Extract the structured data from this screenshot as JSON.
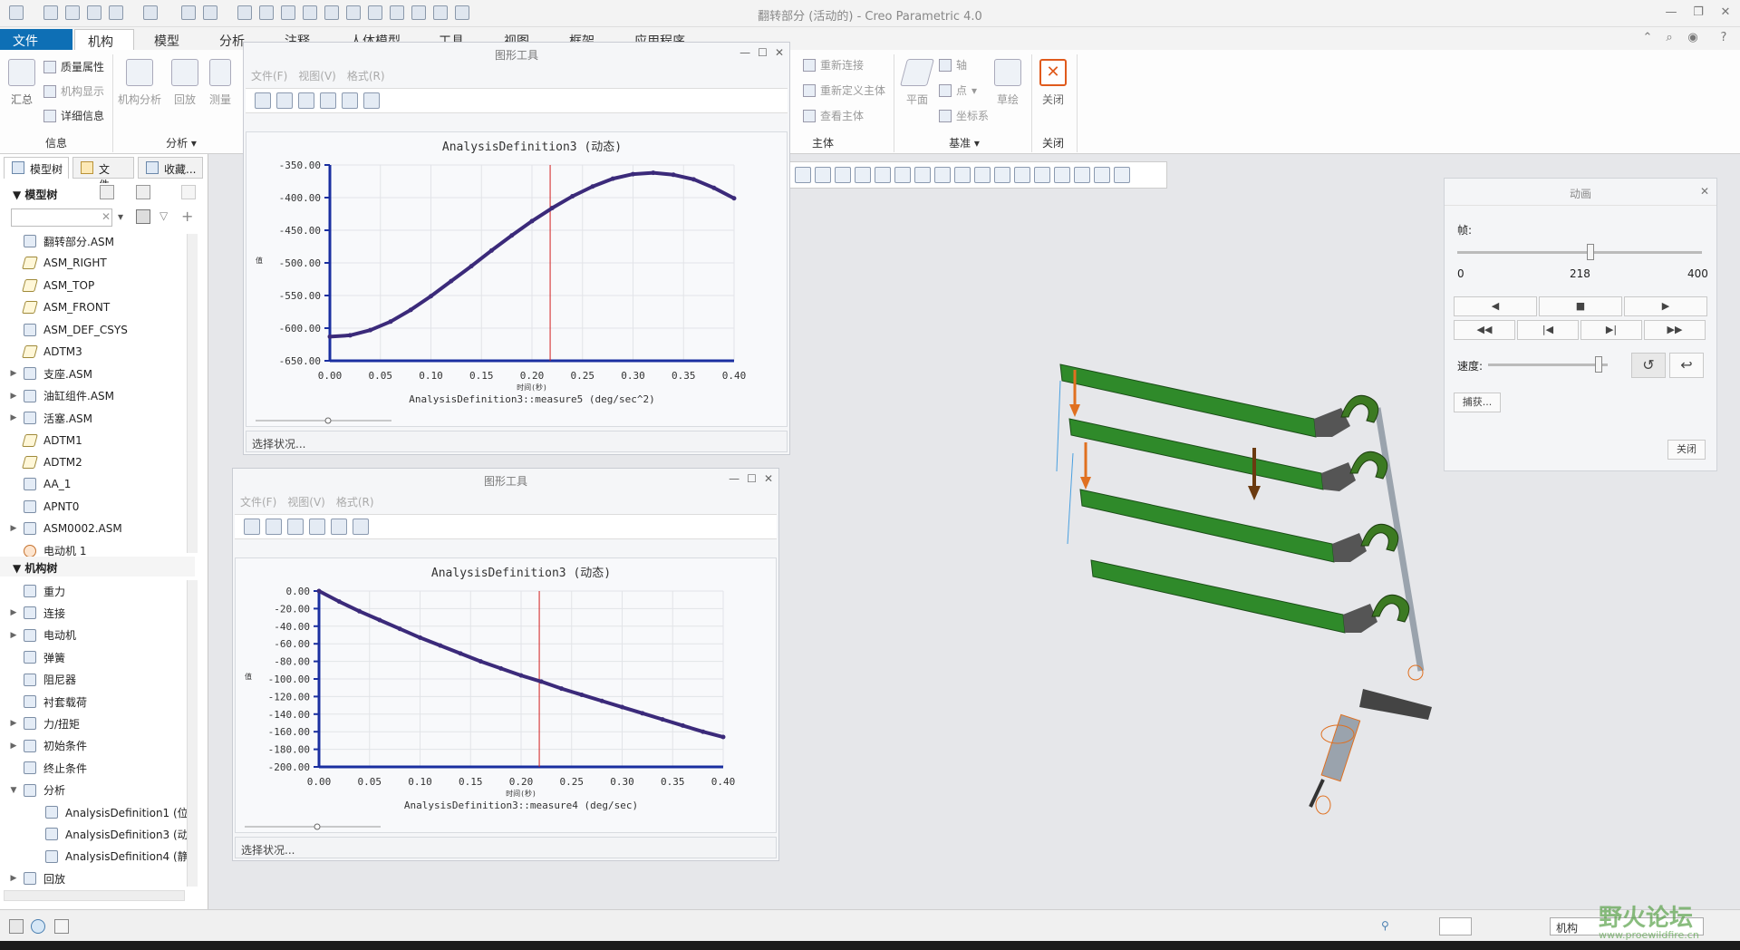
{
  "window": {
    "title": "翻转部分 (活动的) - Creo Parametric 4.0"
  },
  "tabs": [
    "文件",
    "机构",
    "模型",
    "分析",
    "注释",
    "人体模型",
    "工具",
    "视图",
    "框架",
    "应用程序"
  ],
  "ribbon": {
    "info_group": {
      "summary": "汇总",
      "mass_props": "质量属性",
      "mech_display": "机构显示",
      "details": "详细信息",
      "label": "信息"
    },
    "analysis_group": {
      "mech_analysis": "机构分析",
      "playback": "回放",
      "measure": "测量",
      "label": "分析"
    },
    "body_group": {
      "reconnect": "重新连接",
      "redefine_body": "重新定义主体",
      "view_body": "查看主体",
      "label": "主体"
    },
    "datum_group": {
      "plane": "平面",
      "axis": "轴",
      "point": "点",
      "csys": "坐标系",
      "sketch": "草绘",
      "label": "基准"
    },
    "close_group": {
      "close": "关闭",
      "label": "关闭"
    }
  },
  "left_panel": {
    "tabs": [
      "模型树",
      "文件...",
      "收藏..."
    ],
    "model_tree_label": "模型树",
    "model_items": [
      {
        "label": "翻转部分.ASM",
        "type": "asm",
        "expand": ""
      },
      {
        "label": "ASM_RIGHT",
        "type": "datum",
        "expand": ""
      },
      {
        "label": "ASM_TOP",
        "type": "datum",
        "expand": ""
      },
      {
        "label": "ASM_FRONT",
        "type": "datum",
        "expand": ""
      },
      {
        "label": "ASM_DEF_CSYS",
        "type": "csys",
        "expand": ""
      },
      {
        "label": "ADTM3",
        "type": "datum",
        "expand": ""
      },
      {
        "label": "支座.ASM",
        "type": "asm",
        "expand": "▶"
      },
      {
        "label": "油缸组件.ASM",
        "type": "asm",
        "expand": "▶"
      },
      {
        "label": "活塞.ASM",
        "type": "asm",
        "expand": "▶"
      },
      {
        "label": "ADTM1",
        "type": "datum",
        "expand": ""
      },
      {
        "label": "ADTM2",
        "type": "datum",
        "expand": ""
      },
      {
        "label": "AA_1",
        "type": "axis",
        "expand": ""
      },
      {
        "label": "APNT0",
        "type": "point",
        "expand": ""
      },
      {
        "label": "ASM0002.ASM",
        "type": "asm",
        "expand": "▶"
      },
      {
        "label": "电动机 1",
        "type": "motor",
        "expand": ""
      }
    ],
    "mech_tree_label": "机构树",
    "mech_items": [
      {
        "label": "重力",
        "expand": "",
        "indent": 0
      },
      {
        "label": "连接",
        "expand": "▶",
        "indent": 0
      },
      {
        "label": "电动机",
        "expand": "▶",
        "indent": 0
      },
      {
        "label": "弹簧",
        "expand": "",
        "indent": 0
      },
      {
        "label": "阻尼器",
        "expand": "",
        "indent": 0
      },
      {
        "label": "衬套载荷",
        "expand": "",
        "indent": 0
      },
      {
        "label": "力/扭矩",
        "expand": "▶",
        "indent": 0
      },
      {
        "label": "初始条件",
        "expand": "▶",
        "indent": 0
      },
      {
        "label": "终止条件",
        "expand": "",
        "indent": 0
      },
      {
        "label": "分析",
        "expand": "▼",
        "indent": 0
      },
      {
        "label": "AnalysisDefinition1 (位",
        "expand": "",
        "indent": 1
      },
      {
        "label": "AnalysisDefinition3 (动",
        "expand": "",
        "indent": 1
      },
      {
        "label": "AnalysisDefinition4 (静",
        "expand": "",
        "indent": 1
      },
      {
        "label": "回放",
        "expand": "▶",
        "indent": 0
      }
    ]
  },
  "graph_windows": [
    {
      "title": "图形工具",
      "menu": [
        "文件(F)",
        "视图(V)",
        "格式(R)"
      ],
      "status": "选择状况...",
      "chart_data": {
        "type": "line",
        "title": "AnalysisDefinition3 (动态)",
        "xlabel": "时间(秒)",
        "ylabel": "AnalysisDefinition3::measure5 (deg/sec^2)",
        "ytitle_short": "值",
        "xlim": [
          0,
          0.4
        ],
        "ylim": [
          -650,
          -350
        ],
        "xticks": [
          "0.00",
          "0.05",
          "0.10",
          "0.15",
          "0.20",
          "0.25",
          "0.30",
          "0.35",
          "0.40"
        ],
        "yticks": [
          "-350.00",
          "-400.00",
          "-450.00",
          "-500.00",
          "-550.00",
          "-600.00",
          "-650.00"
        ],
        "marker_x": 0.218,
        "series": [
          {
            "x": [
              0.0,
              0.02,
              0.04,
              0.06,
              0.08,
              0.1,
              0.12,
              0.14,
              0.16,
              0.18,
              0.2,
              0.22,
              0.24,
              0.26,
              0.28,
              0.3,
              0.32,
              0.34,
              0.36,
              0.38,
              0.4
            ],
            "values": [
              -613,
              -611,
              -603,
              -590,
              -572,
              -551,
              -528,
              -505,
              -481,
              -458,
              -436,
              -416,
              -398,
              -383,
              -371,
              -364,
              -362,
              -365,
              -372,
              -385,
              -401
            ]
          }
        ]
      }
    },
    {
      "title": "图形工具",
      "menu": [
        "文件(F)",
        "视图(V)",
        "格式(R)"
      ],
      "status": "选择状况...",
      "chart_data": {
        "type": "line",
        "title": "AnalysisDefinition3 (动态)",
        "xlabel": "时间(秒)",
        "ylabel": "AnalysisDefinition3::measure4 (deg/sec)",
        "ytitle_short": "值",
        "xlim": [
          0,
          0.4
        ],
        "ylim": [
          -200,
          0
        ],
        "xticks": [
          "0.00",
          "0.05",
          "0.10",
          "0.15",
          "0.20",
          "0.25",
          "0.30",
          "0.35",
          "0.40"
        ],
        "yticks": [
          "0.00",
          "-20.00",
          "-40.00",
          "-60.00",
          "-80.00",
          "-100.00",
          "-120.00",
          "-140.00",
          "-160.00",
          "-180.00",
          "-200.00"
        ],
        "marker_x": 0.218,
        "series": [
          {
            "x": [
              0.0,
              0.02,
              0.04,
              0.06,
              0.08,
              0.1,
              0.12,
              0.14,
              0.16,
              0.18,
              0.2,
              0.22,
              0.24,
              0.26,
              0.28,
              0.3,
              0.32,
              0.34,
              0.36,
              0.38,
              0.4
            ],
            "values": [
              0,
              -12,
              -23,
              -33,
              -43,
              -53,
              -62,
              -71,
              -80,
              -88,
              -96,
              -103,
              -111,
              -118,
              -125,
              -132,
              -139,
              -146,
              -153,
              -160,
              -166
            ]
          }
        ]
      }
    }
  ],
  "animation": {
    "title": "动画",
    "frame_label": "帧:",
    "frame_min": "0",
    "frame_value": "218",
    "frame_max": "400",
    "frame_fraction": 0.545,
    "speed_label": "速度:",
    "speed_fraction": 0.95,
    "capture": "捕获...",
    "close": "关闭"
  },
  "status_bar": {
    "filter": "机构"
  },
  "watermark": {
    "text": "野火论坛",
    "url": "www.proewildfire.cn"
  },
  "colors": {
    "accent": "#0e6fb5",
    "plot_line": "#3b2a7a",
    "marker": "#d21e1e",
    "part_green": "#2f8a2a"
  }
}
